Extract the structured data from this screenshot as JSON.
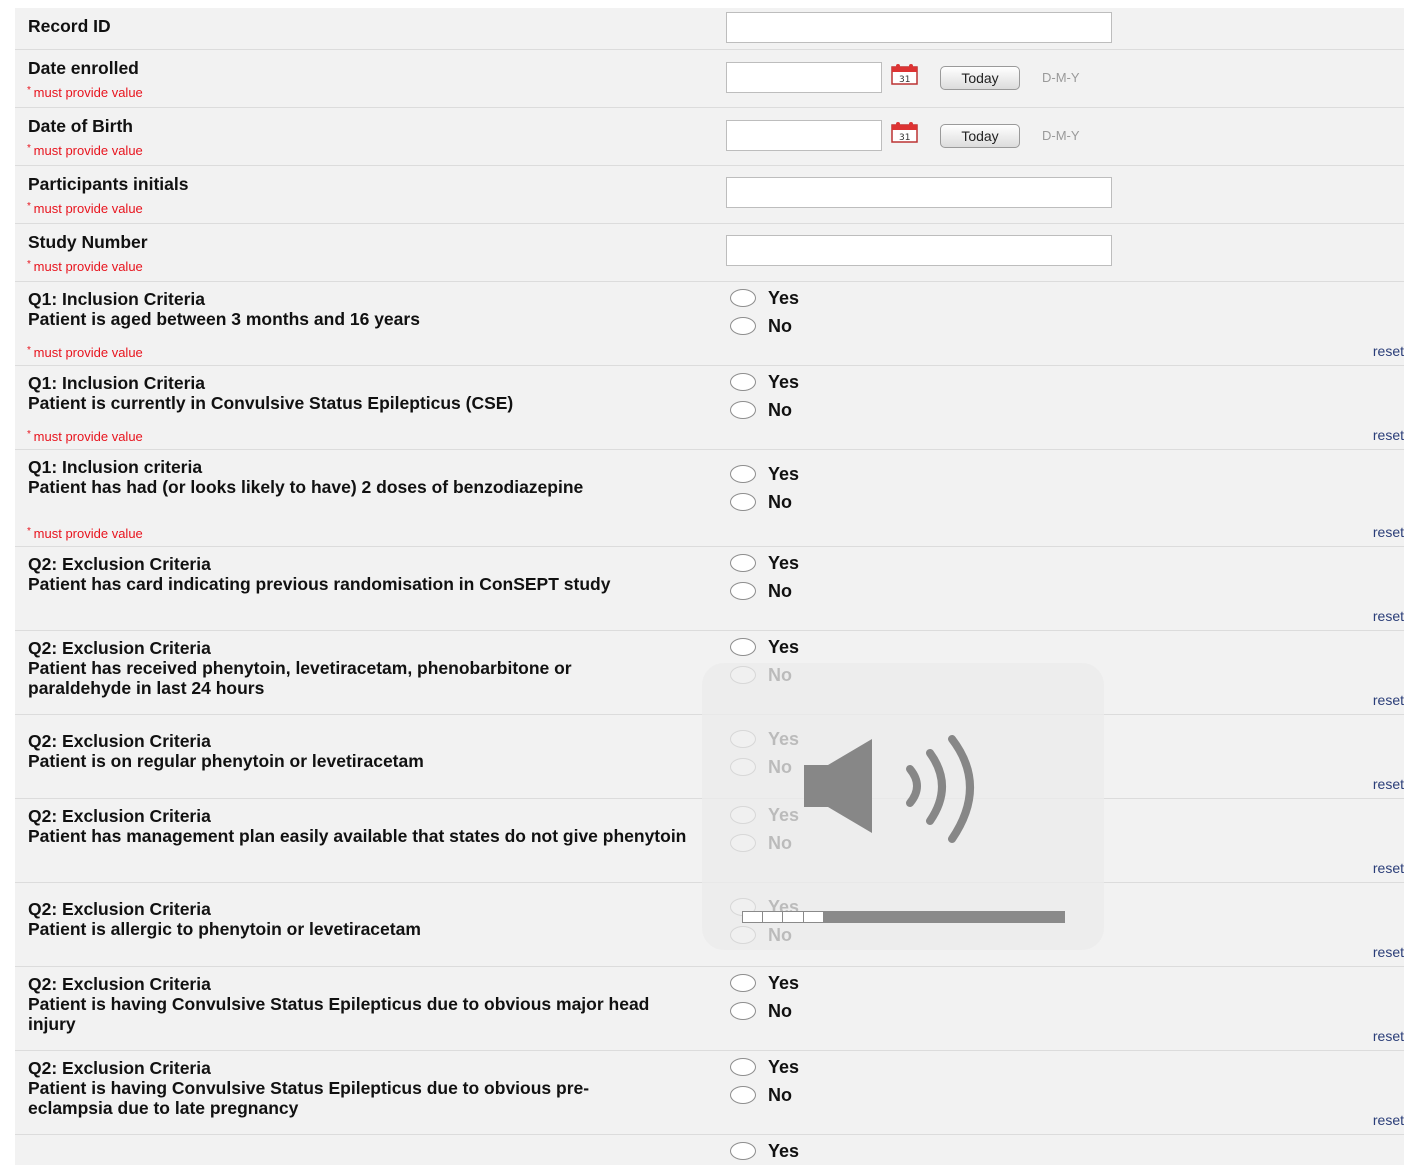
{
  "required_note": "must provide value",
  "reset_label": "reset",
  "text_fields": [
    {
      "label": "Record ID"
    },
    {
      "label": "Date enrolled",
      "today": "Today",
      "format": "D-M-Y",
      "required": true
    },
    {
      "label": "Date of Birth",
      "today": "Today",
      "format": "D-M-Y",
      "required": true
    },
    {
      "label": "Participants initials",
      "required": true
    },
    {
      "label": "Study Number",
      "required": true
    }
  ],
  "questions": [
    {
      "header": "Q1: Inclusion Criteria",
      "text": "Patient is aged between 3 months and 16 years",
      "required": true
    },
    {
      "header": "Q1: Inclusion Criteria",
      "text": "Patient is currently in Convulsive Status Epilepticus (CSE)",
      "required": true
    },
    {
      "header": "Q1: Inclusion criteria",
      "text": "Patient has had (or looks likely to have) 2 doses of benzodiazepine",
      "required": true
    },
    {
      "header": "Q2: Exclusion Criteria",
      "text": "Patient has card indicating previous randomisation in ConSEPT study"
    },
    {
      "header": "Q2: Exclusion Criteria",
      "text": "Patient has received phenytoin, levetiracetam, phenobarbitone or paraldehyde in last 24 hours"
    },
    {
      "header": "Q2: Exclusion Criteria",
      "text": "Patient is on regular phenytoin or levetiracetam"
    },
    {
      "header": "Q2: Exclusion Criteria",
      "text": "Patient has management plan easily available that states do not give phenytoin"
    },
    {
      "header": "Q2: Exclusion Criteria",
      "text": "Patient is allergic to phenytoin or levetiracetam"
    },
    {
      "header": "Q2: Exclusion Criteria",
      "text": "Patient is having Convulsive Status Epilepticus due to obvious major head injury"
    },
    {
      "header": "Q2: Exclusion Criteria",
      "text": "Patient is having Convulsive Status Epilepticus due to obvious pre-eclampsia due to late pregnancy"
    }
  ],
  "options": {
    "yes": "Yes",
    "no": "No"
  },
  "volume_overlay": {
    "icon": "speaker-volume-icon",
    "level_fraction": 0.25,
    "segments": 16,
    "filled_segments": 4
  }
}
